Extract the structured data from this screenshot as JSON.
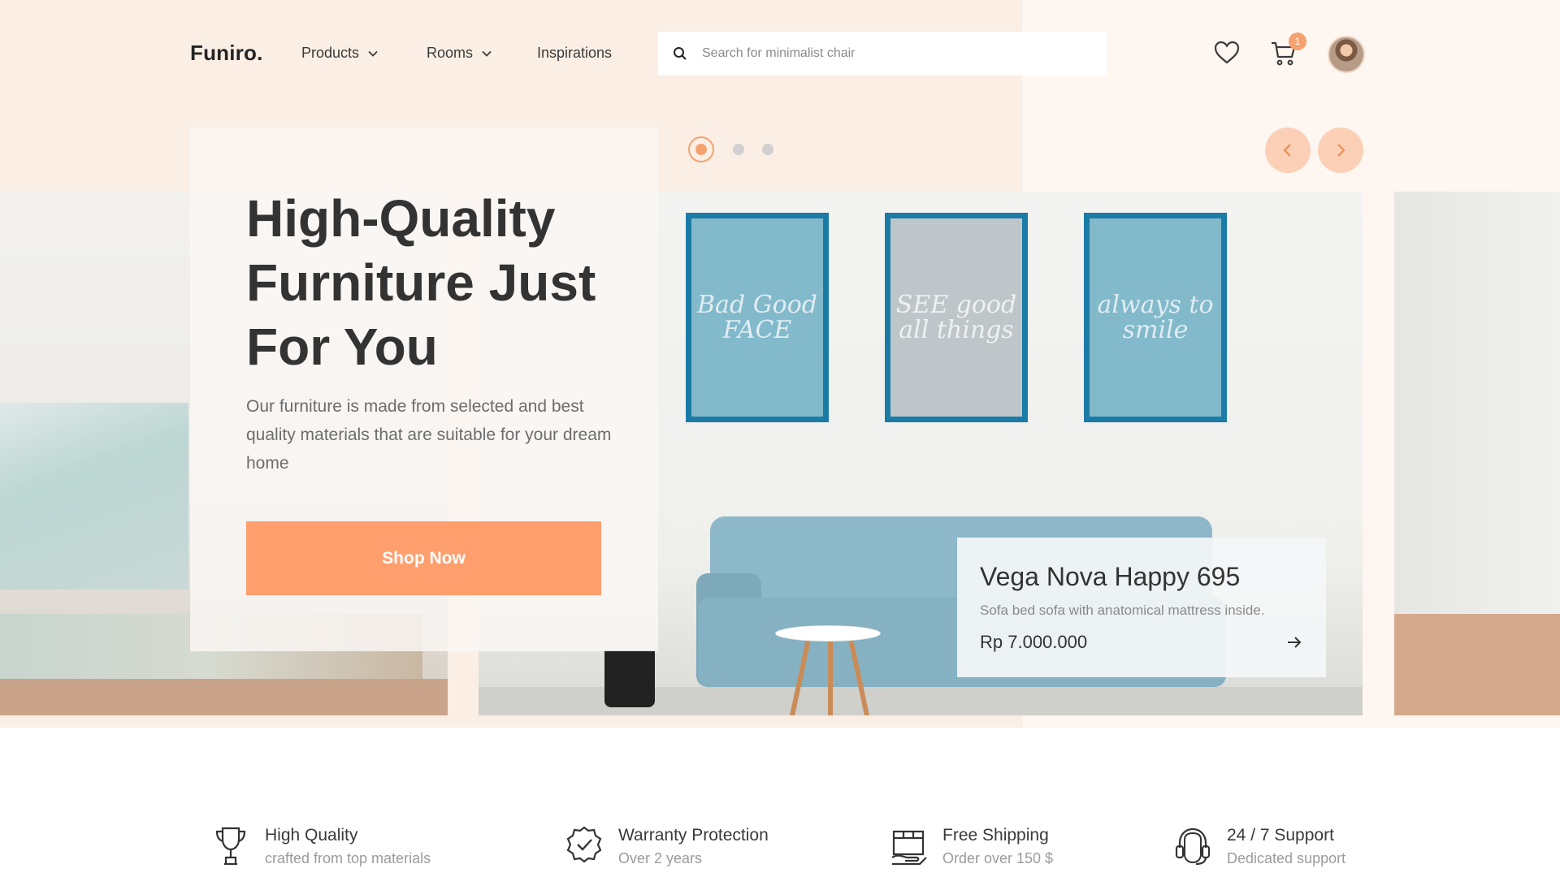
{
  "header": {
    "logo": "Funiro.",
    "nav": [
      {
        "label": "Products"
      },
      {
        "label": "Rooms"
      },
      {
        "label": "Inspirations"
      }
    ],
    "search": {
      "placeholder": "Search for minimalist chair",
      "value": ""
    },
    "cart_count": "1"
  },
  "hero": {
    "title": "High-Quality Furniture Just For You",
    "description": "Our furniture is made from selected and best quality materials that are suitable for your dream home",
    "cta_label": "Shop Now",
    "active_slide": 1,
    "slide_count": 3,
    "frames": [
      "Bad Good FACE",
      "SEE good all things",
      "always to smile"
    ]
  },
  "product": {
    "name": "Vega Nova Happy 695",
    "description": "Sofa bed sofa with anatomical mattress inside.",
    "price": "Rp 7.000.000"
  },
  "features": [
    {
      "title": "High Quality",
      "subtitle": "crafted from top materials",
      "icon": "trophy-icon"
    },
    {
      "title": "Warranty Protection",
      "subtitle": "Over 2 years",
      "icon": "badge-check-icon"
    },
    {
      "title": "Free Shipping",
      "subtitle": "Order over 150 $",
      "icon": "shipping-box-icon"
    },
    {
      "title": "24 / 7 Support",
      "subtitle": "Dedicated support",
      "icon": "headset-icon"
    }
  ],
  "colors": {
    "accent": "#ff9f6e",
    "peach_bg": "#fbeee4",
    "frame_blue": "#1a7ba6",
    "text_dark": "#333333"
  }
}
